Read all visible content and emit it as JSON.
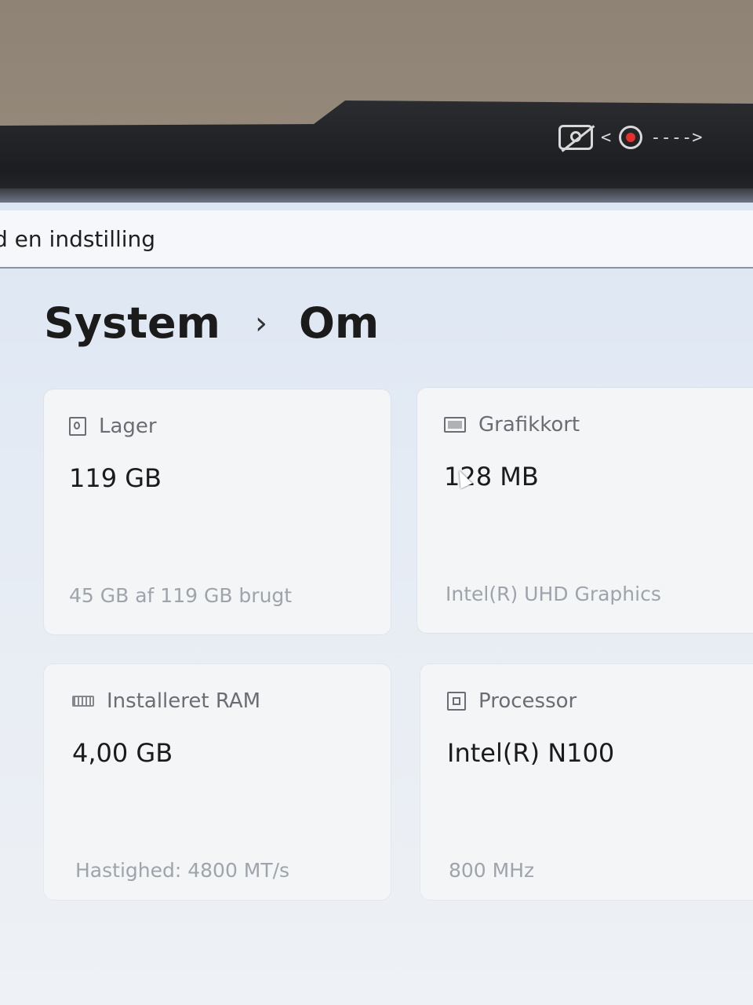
{
  "window": {
    "search_text": "d en indstilling",
    "camera_shutter_arrow": "<-----→"
  },
  "breadcrumb": {
    "parent": "System",
    "separator": "›",
    "current": "Om"
  },
  "cards": [
    {
      "icon": "storage-icon",
      "title": "Lager",
      "value": "119 GB",
      "sub": "45 GB af 119 GB brugt"
    },
    {
      "icon": "graphics-card-icon",
      "title": "Grafikkort",
      "value": "128 MB",
      "sub": "Intel(R) UHD Graphics"
    },
    {
      "icon": "ram-icon",
      "title": "Installeret RAM",
      "value": "4,00 GB",
      "sub": "Hastighed: 4800 MT/s"
    },
    {
      "icon": "processor-icon",
      "title": "Processor",
      "value": "Intel(R) N100",
      "sub": "800 MHz"
    }
  ]
}
